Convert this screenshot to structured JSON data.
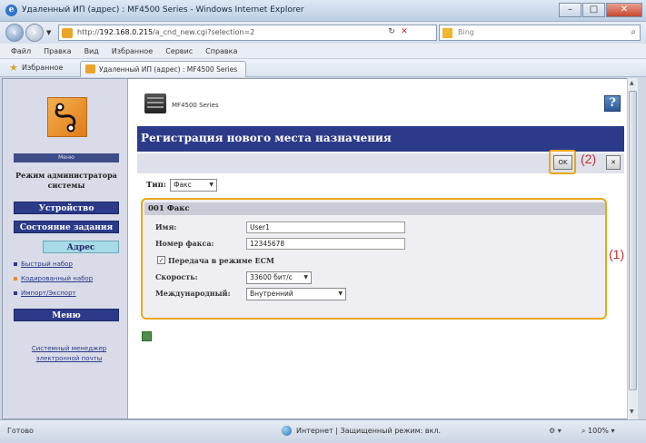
{
  "window": {
    "title": "Удаленный ИП (адрес) : MF4500 Series - Windows Internet Explorer",
    "minimize": "–",
    "maximize": "□",
    "close": "✕"
  },
  "address_bar": {
    "url_prefix": "http://",
    "url_host": "192.168.0.215",
    "url_path": "/a_cnd_new.cgi?selection=2",
    "search_placeholder": "Bing"
  },
  "menu": [
    "Файл",
    "Правка",
    "Вид",
    "Избранное",
    "Сервис",
    "Справка"
  ],
  "favorites": {
    "label": "Избранное",
    "tab_label": "Удаленный ИП (адрес) : MF4500 Series"
  },
  "sidebar": {
    "logo_caption": "Меню",
    "admin_mode": "Режим администратора системы",
    "nav": [
      "Устройство",
      "Состояние задания",
      "Адрес"
    ],
    "links": [
      "Быстрый набор",
      "Кодированный набор",
      "Импорт/Экспорт"
    ],
    "menu_button": "Меню",
    "note": "Системный менеджер электронной почты"
  },
  "main": {
    "device_name": "MF4500 Series",
    "help": "?",
    "page_title": "Регистрация нового места назначения",
    "ok_label": "OK",
    "cancel_label": "",
    "annotation_2": "(2)",
    "annotation_1": "(1)",
    "type_label": "Тип:",
    "type_value": "Факс",
    "section_header": "001 Факс",
    "fields": {
      "name_label": "Имя:",
      "name_value": "User1",
      "fax_label": "Номер факса:",
      "fax_value": "12345678",
      "ecm_label": "Передача в режиме ECM",
      "ecm_checked": true,
      "speed_label": "Скорость:",
      "speed_value": "33600 бит/с",
      "intl_label": "Международный:",
      "intl_value": "Внутренний"
    }
  },
  "status": {
    "text": "Готово",
    "zone": "Интернет | Защищенный режим: вкл.",
    "zoom": "100%"
  }
}
